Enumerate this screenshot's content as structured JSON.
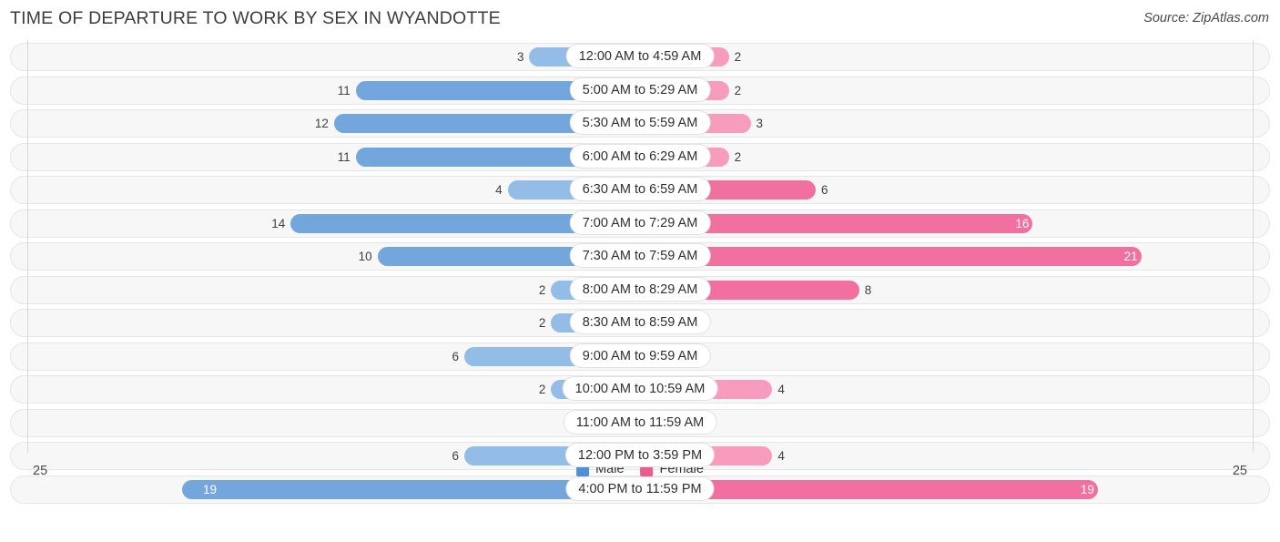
{
  "header": {
    "title": "TIME OF DEPARTURE TO WORK BY SEX IN WYANDOTTE",
    "source": "Source: ZipAtlas.com"
  },
  "legend": {
    "male_label": "Male",
    "female_label": "Female",
    "male_color": "#4d90d9",
    "female_color": "#ef5a8c"
  },
  "axis": {
    "left_tick": "25",
    "right_tick": "25",
    "max": 25
  },
  "chart_data": {
    "type": "bar",
    "title": "TIME OF DEPARTURE TO WORK BY SEX IN WYANDOTTE",
    "subtitle": "",
    "xlabel": "",
    "ylabel": "",
    "orientation": "horizontal",
    "style": "diverging-bidirectional",
    "legend_position": "bottom-center",
    "grid": false,
    "xlim": [
      25,
      25
    ],
    "categories": [
      "12:00 AM to 4:59 AM",
      "5:00 AM to 5:29 AM",
      "5:30 AM to 5:59 AM",
      "6:00 AM to 6:29 AM",
      "6:30 AM to 6:59 AM",
      "7:00 AM to 7:29 AM",
      "7:30 AM to 7:59 AM",
      "8:00 AM to 8:29 AM",
      "8:30 AM to 8:59 AM",
      "9:00 AM to 9:59 AM",
      "10:00 AM to 10:59 AM",
      "11:00 AM to 11:59 AM",
      "12:00 PM to 3:59 PM",
      "4:00 PM to 11:59 PM"
    ],
    "series": [
      {
        "name": "Male",
        "color": "#4d90d9",
        "values": [
          3,
          11,
          12,
          11,
          4,
          14,
          10,
          2,
          2,
          6,
          2,
          0,
          6,
          19
        ]
      },
      {
        "name": "Female",
        "color": "#ef5a8c",
        "values": [
          2,
          2,
          3,
          2,
          6,
          16,
          21,
          8,
          0,
          0,
          4,
          0,
          4,
          19
        ]
      }
    ]
  },
  "rows": [
    {
      "category": "12:00 AM to 4:59 AM",
      "male": "3",
      "female": "2"
    },
    {
      "category": "5:00 AM to 5:29 AM",
      "male": "11",
      "female": "2"
    },
    {
      "category": "5:30 AM to 5:59 AM",
      "male": "12",
      "female": "3"
    },
    {
      "category": "6:00 AM to 6:29 AM",
      "male": "11",
      "female": "2"
    },
    {
      "category": "6:30 AM to 6:59 AM",
      "male": "4",
      "female": "6"
    },
    {
      "category": "7:00 AM to 7:29 AM",
      "male": "14",
      "female": "16"
    },
    {
      "category": "7:30 AM to 7:59 AM",
      "male": "10",
      "female": "21"
    },
    {
      "category": "8:00 AM to 8:29 AM",
      "male": "2",
      "female": "8"
    },
    {
      "category": "8:30 AM to 8:59 AM",
      "male": "2",
      "female": "0"
    },
    {
      "category": "9:00 AM to 9:59 AM",
      "male": "6",
      "female": "0"
    },
    {
      "category": "10:00 AM to 10:59 AM",
      "male": "2",
      "female": "4"
    },
    {
      "category": "11:00 AM to 11:59 AM",
      "male": "0",
      "female": "0"
    },
    {
      "category": "12:00 PM to 3:59 PM",
      "male": "6",
      "female": "4"
    },
    {
      "category": "4:00 PM to 11:59 PM",
      "male": "19",
      "female": "19"
    }
  ]
}
